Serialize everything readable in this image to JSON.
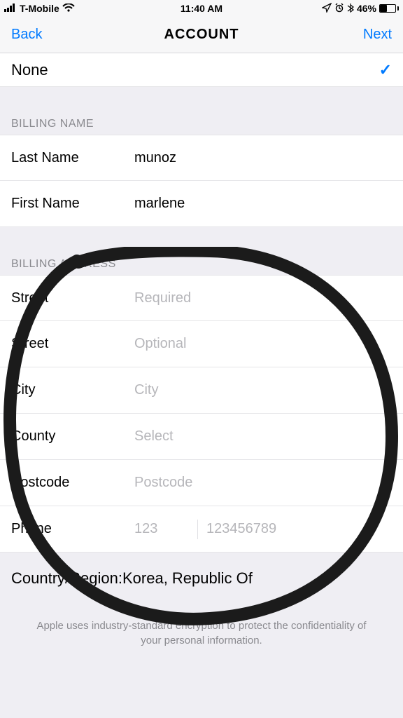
{
  "status_bar": {
    "carrier": "T-Mobile",
    "time": "11:40 AM",
    "battery": "46%"
  },
  "nav": {
    "back": "Back",
    "title": "ACCOUNT",
    "next": "Next"
  },
  "top_row": {
    "label": "None"
  },
  "billing_name": {
    "header": "BILLING NAME",
    "last_name_label": "Last Name",
    "last_name_value": "munoz",
    "first_name_label": "First Name",
    "first_name_value": "marlene"
  },
  "billing_address": {
    "header": "BILLING ADDRESS",
    "street1_label": "Street",
    "street1_placeholder": "Required",
    "street2_label": "Street",
    "street2_placeholder": "Optional",
    "city_label": "City",
    "city_placeholder": "City",
    "county_label": "County",
    "county_placeholder": "Select",
    "postcode_label": "Postcode",
    "postcode_placeholder": "Postcode",
    "phone_label": "Phone",
    "phone_prefix_placeholder": "123",
    "phone_number_placeholder": "123456789"
  },
  "country": {
    "label": "Country/Region: ",
    "value": "Korea, Republic Of"
  },
  "footer": "Apple uses industry-standard encryption to protect the confidentiality of your personal information."
}
